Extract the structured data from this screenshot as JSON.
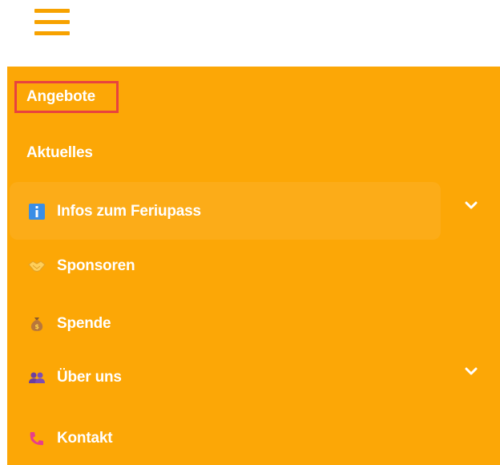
{
  "header": {
    "menu_icon": "hamburger-menu-icon"
  },
  "menu": {
    "items": [
      {
        "label": "Angebote",
        "icon": null,
        "highlighted": true
      },
      {
        "label": "Aktuelles",
        "icon": null
      },
      {
        "label": "Infos zum Feriupass",
        "icon": "info-icon",
        "has_submenu": true
      },
      {
        "label": "Sponsoren",
        "icon": "handshake-icon"
      },
      {
        "label": "Spende",
        "icon": "money-bag-icon"
      },
      {
        "label": "Über uns",
        "icon": "people-icon",
        "has_submenu": true
      },
      {
        "label": "Kontakt",
        "icon": "telephone-icon"
      }
    ]
  },
  "colors": {
    "menu_background": "#fca706",
    "menu_icon": "#f7a200",
    "highlight_border": "#e8423f",
    "text": "#ffffff"
  }
}
